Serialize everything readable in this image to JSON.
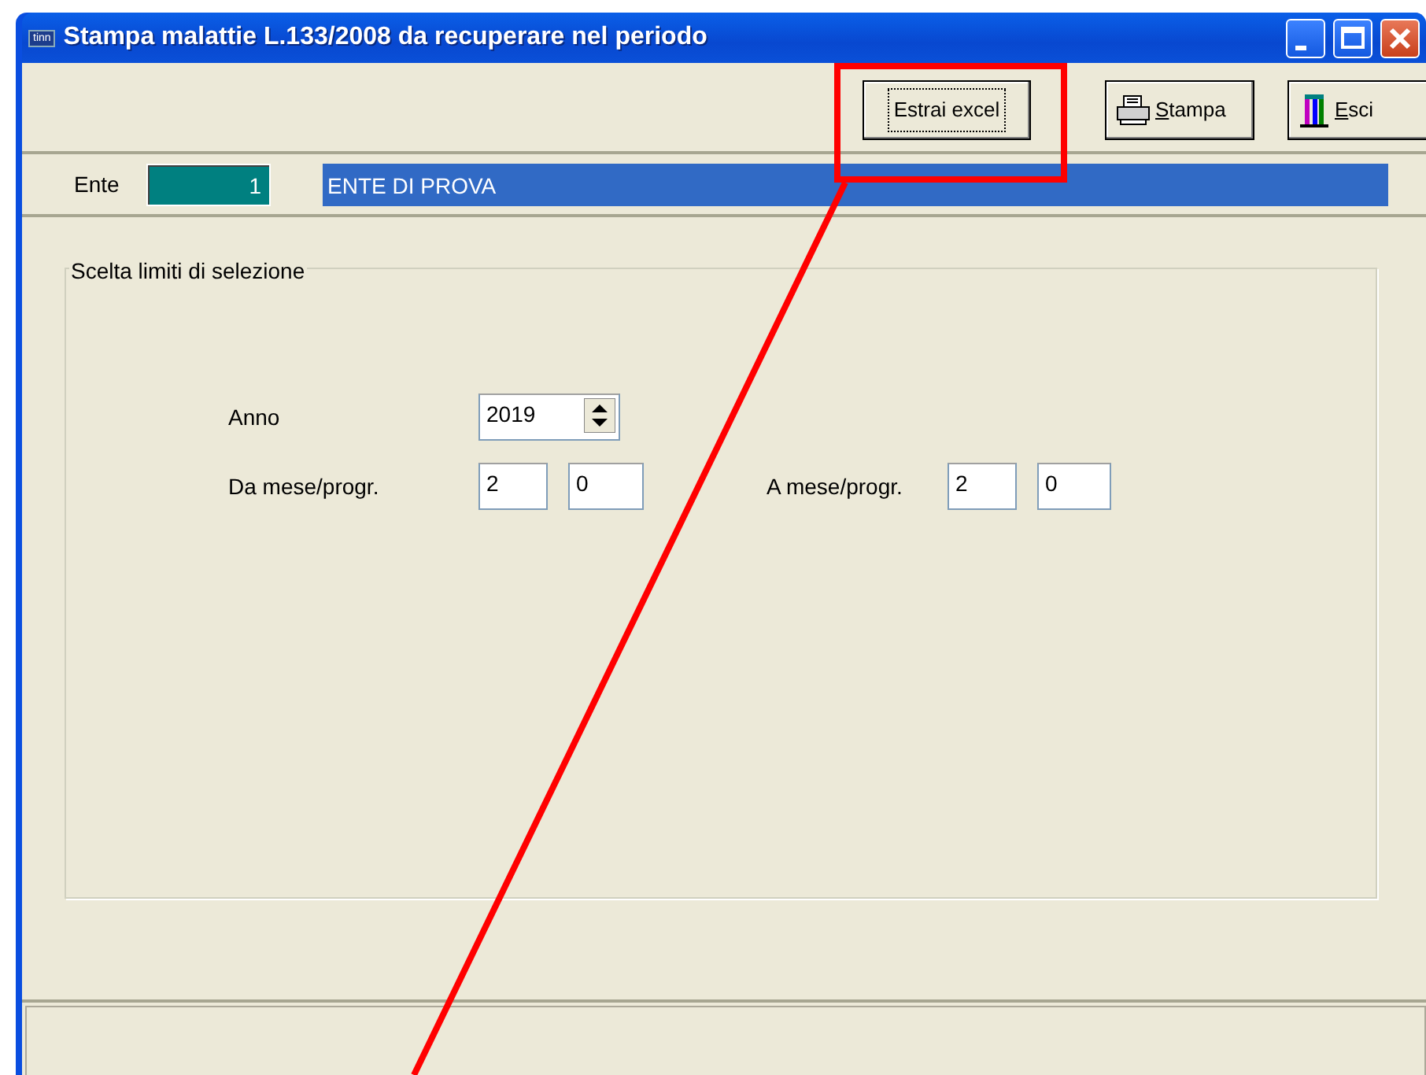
{
  "window": {
    "icon_label": "tinn",
    "title": "Stampa malattie L.133/2008 da recuperare nel periodo",
    "controls": [
      {
        "kind": "minimize"
      },
      {
        "kind": "maximize"
      },
      {
        "kind": "close"
      }
    ]
  },
  "toolbar": {
    "buttons": [
      {
        "kind": "plain",
        "label": "Estrai excel",
        "focused": true,
        "mnemonic": false
      },
      {
        "kind": "print",
        "label": "Stampa",
        "focused": false,
        "mnemonic": true
      },
      {
        "kind": "exit",
        "label": "Esci",
        "focused": false,
        "mnemonic": true
      }
    ]
  },
  "ente": {
    "label": "Ente",
    "code": "1",
    "name": "ENTE DI PROVA"
  },
  "selection": {
    "title": "Scelta limiti di selezione",
    "anno": {
      "label": "Anno",
      "value": "2019"
    },
    "da": {
      "label": "Da mese/progr.",
      "month": "2",
      "progr": "0"
    },
    "a": {
      "label": "A mese/progr.",
      "month": "2",
      "progr": "0"
    }
  },
  "annotation": {
    "highlight_box": true,
    "pointer_line": true
  }
}
